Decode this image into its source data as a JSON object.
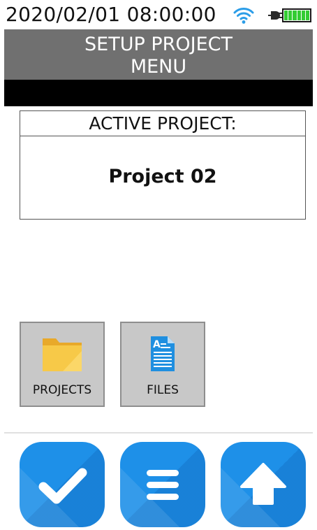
{
  "status": {
    "datetime": "2020/02/01 08:00:00",
    "wifi_icon": "wifi-icon",
    "power_icon": "plug-icon",
    "battery_icon": "battery-full-icon"
  },
  "header": {
    "title_line1": "SETUP PROJECT",
    "title_line2": "MENU"
  },
  "active_project": {
    "heading": "ACTIVE PROJECT:",
    "name": "Project 02"
  },
  "tiles": [
    {
      "label": "PROJECTS",
      "icon": "folder-icon"
    },
    {
      "label": "FILES",
      "icon": "document-icon"
    }
  ],
  "bottom_buttons": [
    {
      "icon": "checkmark-icon",
      "action": "confirm"
    },
    {
      "icon": "menu-icon",
      "action": "menu"
    },
    {
      "icon": "arrow-up-icon",
      "action": "up"
    }
  ],
  "colors": {
    "title_bar": "#707070",
    "button_blue": "#1e90e8",
    "battery_green": "#33cc33",
    "folder_yellow": "#f5c542",
    "document_blue": "#1f8fe0"
  }
}
